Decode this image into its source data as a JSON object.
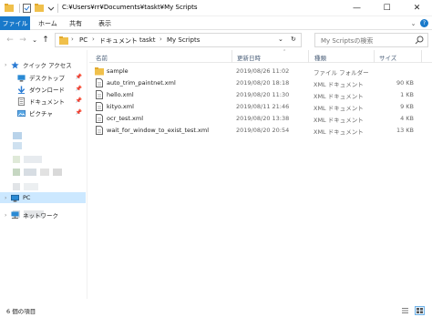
{
  "window": {
    "title": "C:¥Users¥rr¥Documents¥taskt¥My Scripts",
    "minimize": "—",
    "maximize": "☐",
    "close": "✕"
  },
  "ribbon": {
    "tabs": [
      "ファイル",
      "ホーム",
      "共有",
      "表示"
    ],
    "expand": "⌄",
    "help": "?"
  },
  "nav_buttons": {
    "back": "←",
    "forward": "→",
    "recent": "⌄",
    "up": "↑"
  },
  "address": {
    "crumbs": [
      "PC",
      "ドキュメント",
      "taskt",
      "My Scripts"
    ],
    "sep": "›",
    "dropdown": "⌄",
    "refresh": "↻"
  },
  "search": {
    "placeholder": "My Scriptsの検索"
  },
  "nav_pane": {
    "quick_access": "クイック アクセス",
    "items": [
      {
        "label": "デスクトップ",
        "icon": "desktop-icon"
      },
      {
        "label": "ダウンロード",
        "icon": "download-icon"
      },
      {
        "label": "ドキュメント",
        "icon": "documents-icon"
      },
      {
        "label": "ピクチャ",
        "icon": "pictures-icon"
      }
    ],
    "pc": "PC",
    "network": "ネットワーク",
    "pin_glyph": "📌"
  },
  "columns": {
    "name": "名前",
    "date": "更新日時",
    "type": "種類",
    "size": "サイズ"
  },
  "files": [
    {
      "name": "sample",
      "date": "2019/08/26 11:02",
      "type": "ファイル フォルダー",
      "size": "",
      "kind": "folder"
    },
    {
      "name": "auto_trim_paintnet.xml",
      "date": "2019/08/20 18:18",
      "type": "XML ドキュメント",
      "size": "90 KB",
      "kind": "xml"
    },
    {
      "name": "hello.xml",
      "date": "2019/08/20 11:30",
      "type": "XML ドキュメント",
      "size": "1 KB",
      "kind": "xml"
    },
    {
      "name": "kityo.xml",
      "date": "2019/08/11 21:46",
      "type": "XML ドキュメント",
      "size": "9 KB",
      "kind": "xml"
    },
    {
      "name": "ocr_test.xml",
      "date": "2019/08/20 13:38",
      "type": "XML ドキュメント",
      "size": "4 KB",
      "kind": "xml"
    },
    {
      "name": "wait_for_window_to_exist_test.xml",
      "date": "2019/08/20 20:54",
      "type": "XML ドキュメント",
      "size": "13 KB",
      "kind": "xml"
    }
  ],
  "status": {
    "count": "6 個の項目"
  },
  "colors": {
    "accent": "#1979ca",
    "folder": "#f0c04b",
    "selection": "#cce8ff",
    "header_text": "#4c607a"
  }
}
